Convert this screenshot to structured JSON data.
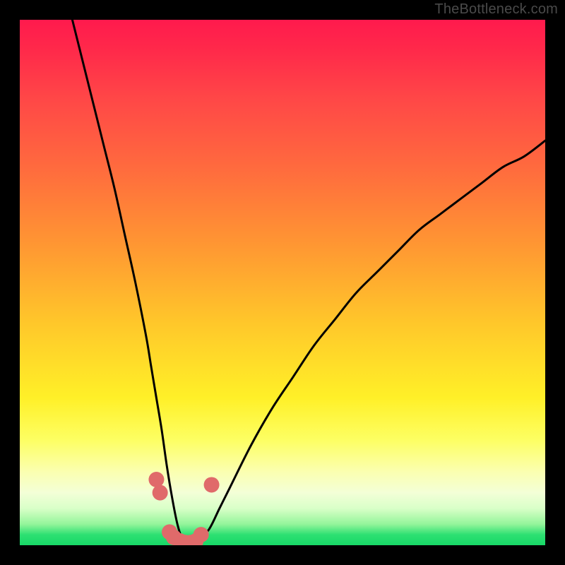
{
  "watermark": "TheBottleneck.com",
  "chart_data": {
    "type": "line",
    "title": "",
    "xlabel": "",
    "ylabel": "",
    "xlim": [
      0,
      100
    ],
    "ylim": [
      0,
      100
    ],
    "grid": false,
    "legend": false,
    "series": [
      {
        "name": "bottleneck-curve",
        "x": [
          10,
          12,
          14,
          16,
          18,
          20,
          22,
          24,
          25,
          26,
          27,
          28,
          29,
          30,
          31,
          32,
          33,
          34,
          36,
          38,
          40,
          44,
          48,
          52,
          56,
          60,
          64,
          68,
          72,
          76,
          80,
          84,
          88,
          92,
          96,
          100
        ],
        "values": [
          100,
          92,
          84,
          76,
          68,
          59,
          50,
          40,
          34,
          28,
          22,
          15,
          9,
          4,
          1,
          0,
          0,
          1,
          3,
          7,
          11,
          19,
          26,
          32,
          38,
          43,
          48,
          52,
          56,
          60,
          63,
          66,
          69,
          72,
          74,
          77
        ]
      }
    ],
    "markers": [
      {
        "name": "marker-left-upper",
        "x": 26.0,
        "y": 12.5
      },
      {
        "name": "marker-left-mid",
        "x": 26.7,
        "y": 10.0
      },
      {
        "name": "marker-left-low-1",
        "x": 28.5,
        "y": 2.5
      },
      {
        "name": "marker-left-low-2",
        "x": 29.3,
        "y": 1.5
      },
      {
        "name": "marker-bottom-1",
        "x": 30.5,
        "y": 0.8
      },
      {
        "name": "marker-bottom-2",
        "x": 31.5,
        "y": 0.5
      },
      {
        "name": "marker-bottom-3",
        "x": 32.5,
        "y": 0.5
      },
      {
        "name": "marker-bottom-4",
        "x": 33.5,
        "y": 0.8
      },
      {
        "name": "marker-right-low",
        "x": 34.5,
        "y": 2.0
      },
      {
        "name": "marker-right-upper",
        "x": 36.5,
        "y": 11.5
      }
    ],
    "marker_style": {
      "color": "#e06a6a",
      "radius_px": 11
    }
  },
  "colors": {
    "curve": "#000000",
    "marker": "#e06a6a",
    "background_top": "#ff1a4d",
    "background_bottom": "#18d867",
    "frame": "#000000",
    "watermark": "#4a4a4a"
  }
}
